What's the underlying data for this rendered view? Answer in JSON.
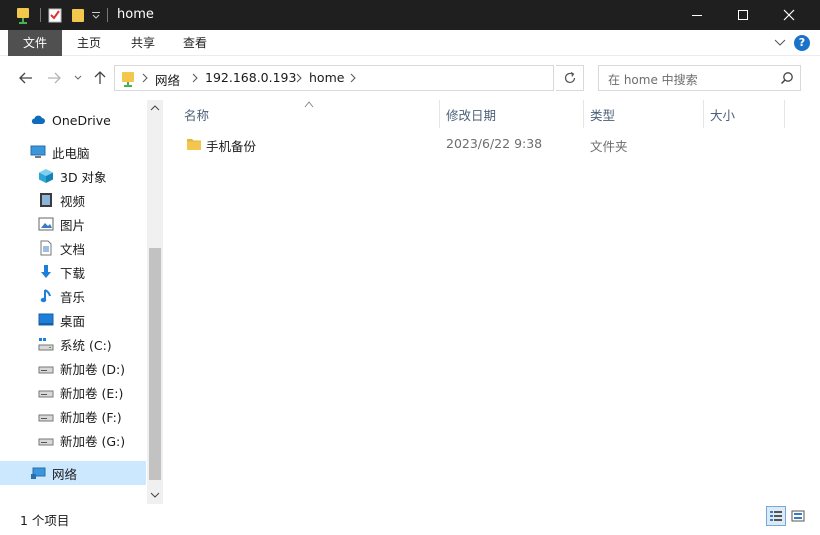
{
  "window": {
    "title": "home"
  },
  "ribbon": {
    "tabs": [
      "文件",
      "主页",
      "共享",
      "查看"
    ],
    "help_label": "?"
  },
  "address": {
    "crumbs": [
      "网络",
      "192.168.0.193",
      "home"
    ]
  },
  "search": {
    "placeholder": "在 home 中搜索"
  },
  "sidebar": {
    "items": [
      {
        "label": "OneDrive",
        "icon": "cloud-icon"
      },
      {
        "label": "此电脑",
        "icon": "computer-icon"
      },
      {
        "label": "3D 对象",
        "icon": "cube-icon"
      },
      {
        "label": "视频",
        "icon": "video-icon"
      },
      {
        "label": "图片",
        "icon": "picture-icon"
      },
      {
        "label": "文档",
        "icon": "document-icon"
      },
      {
        "label": "下载",
        "icon": "download-arrow-icon"
      },
      {
        "label": "音乐",
        "icon": "music-note-icon"
      },
      {
        "label": "桌面",
        "icon": "desktop-icon"
      },
      {
        "label": "系统 (C:)",
        "icon": "system-drive-icon"
      },
      {
        "label": "新加卷 (D:)",
        "icon": "drive-icon"
      },
      {
        "label": "新加卷 (E:)",
        "icon": "drive-icon"
      },
      {
        "label": "新加卷 (F:)",
        "icon": "drive-icon"
      },
      {
        "label": "新加卷 (G:)",
        "icon": "drive-icon"
      },
      {
        "label": "网络",
        "icon": "network-icon",
        "selected": true
      }
    ]
  },
  "list": {
    "columns": [
      "名称",
      "修改日期",
      "类型",
      "大小"
    ],
    "rows": [
      {
        "name": "手机备份",
        "modified": "2023/6/22 9:38",
        "type": "文件夹",
        "size": ""
      }
    ]
  },
  "status": {
    "text": "1 个项目"
  },
  "colors": {
    "titlebar": "#1f1f1f",
    "file_tab": "#505050",
    "selection": "#cce8ff",
    "accent": "#1a73c8",
    "folder": "#f3c74d"
  }
}
